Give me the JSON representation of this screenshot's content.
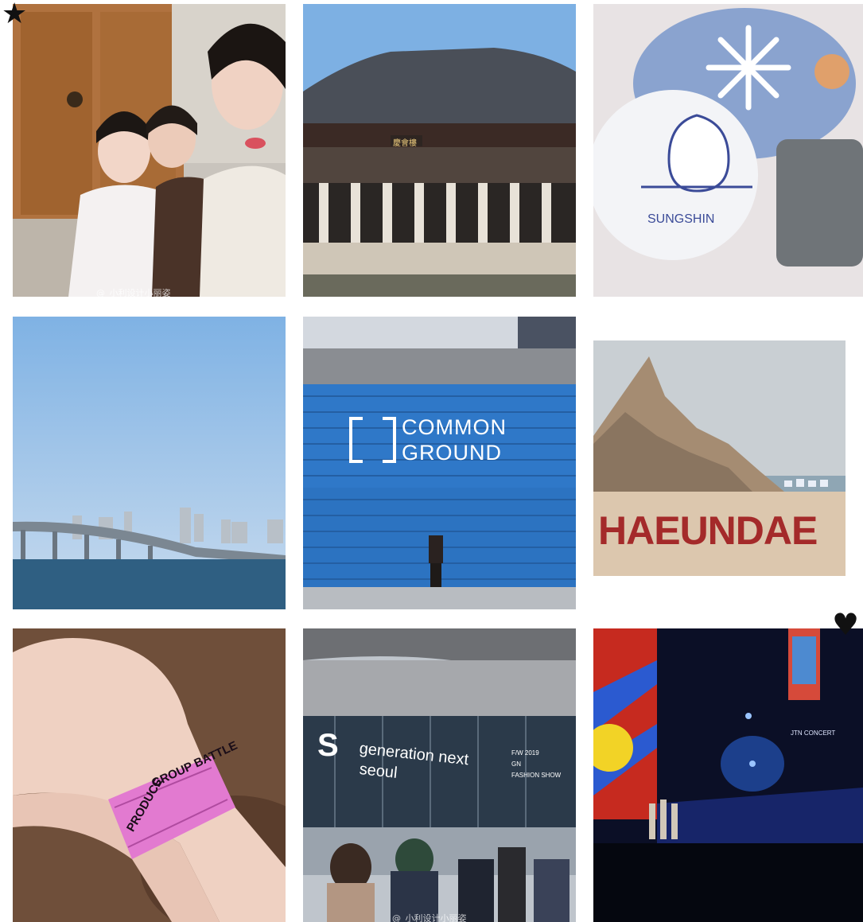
{
  "collage": {
    "tiles": [
      {
        "subject": "hanbok-selfie"
      },
      {
        "subject": "palace-pavilion",
        "sign": "慶會樓"
      },
      {
        "subject": "sungshin-badge",
        "brand": "SUNGSHIN"
      },
      {
        "subject": "river-bridge"
      },
      {
        "subject": "common-ground",
        "line1": "COMMON",
        "line2": "GROUND"
      },
      {
        "subject": "haeundae-sand",
        "sign": "HAEUNDAE"
      },
      {
        "subject": "wristband",
        "band_text": "GROUP BATTLE",
        "band_text2": "PRODUCE"
      },
      {
        "subject": "fashion-week",
        "line1": "generation next",
        "line2": "seoul",
        "small1": "F/W 2019",
        "small2": "GN",
        "small3": "FASHION SHOW",
        "logo": "S"
      },
      {
        "subject": "concert-stage",
        "screen": "JTN CONCERT"
      }
    ],
    "watermarks": {
      "tile1": "@_小利设计小丽姿",
      "tile8": "@_小利设计小丽姿"
    },
    "colors": {
      "background": "#ffffff",
      "sky": "#8fbde6",
      "container_blue": "#2a73c4",
      "haeundae_red": "#a42a2a",
      "wristband_pink": "#e27ad0"
    }
  }
}
